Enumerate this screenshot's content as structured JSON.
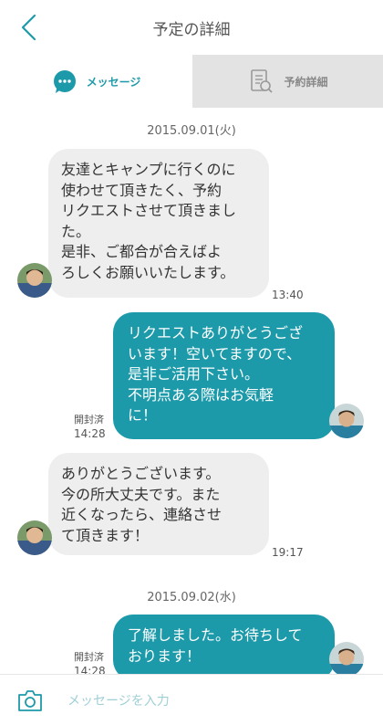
{
  "header": {
    "title": "予定の詳細"
  },
  "tabs": [
    {
      "label": "メッセージ",
      "icon": "chat-bubble-icon"
    },
    {
      "label": "予約詳細",
      "icon": "document-icon"
    }
  ],
  "messages": {
    "date1": "2015.09.01(火)",
    "m1": {
      "text": "友達とキャンプに行くのに\n使わせて頂きたく、予約\nリクエストさせて頂きまし\nた。\n是非、ご都合が合えばよ\nろしくお願いいたします。",
      "time": "13:40"
    },
    "m2": {
      "text": "リクエストありがとうござ\nいます！空いてますので、\n是非ご活用下さい。\n不明点ある際はお気軽\nに！",
      "read": "開封済",
      "time": "14:28"
    },
    "m3": {
      "text": "ありがとうございます。\n今の所大丈夫です。また\n近くなったら、連絡させ\nて頂きます！",
      "time": "19:17"
    },
    "date2": "2015.09.02(水)",
    "m4": {
      "text": "了解しました。お待ちして\nおります！",
      "read": "開封済",
      "time": "14:28"
    }
  },
  "footer": {
    "placeholder": "メッセージを入力"
  },
  "colors": {
    "accent": "#1d9aaa",
    "bubble_in": "#eeeeee"
  }
}
